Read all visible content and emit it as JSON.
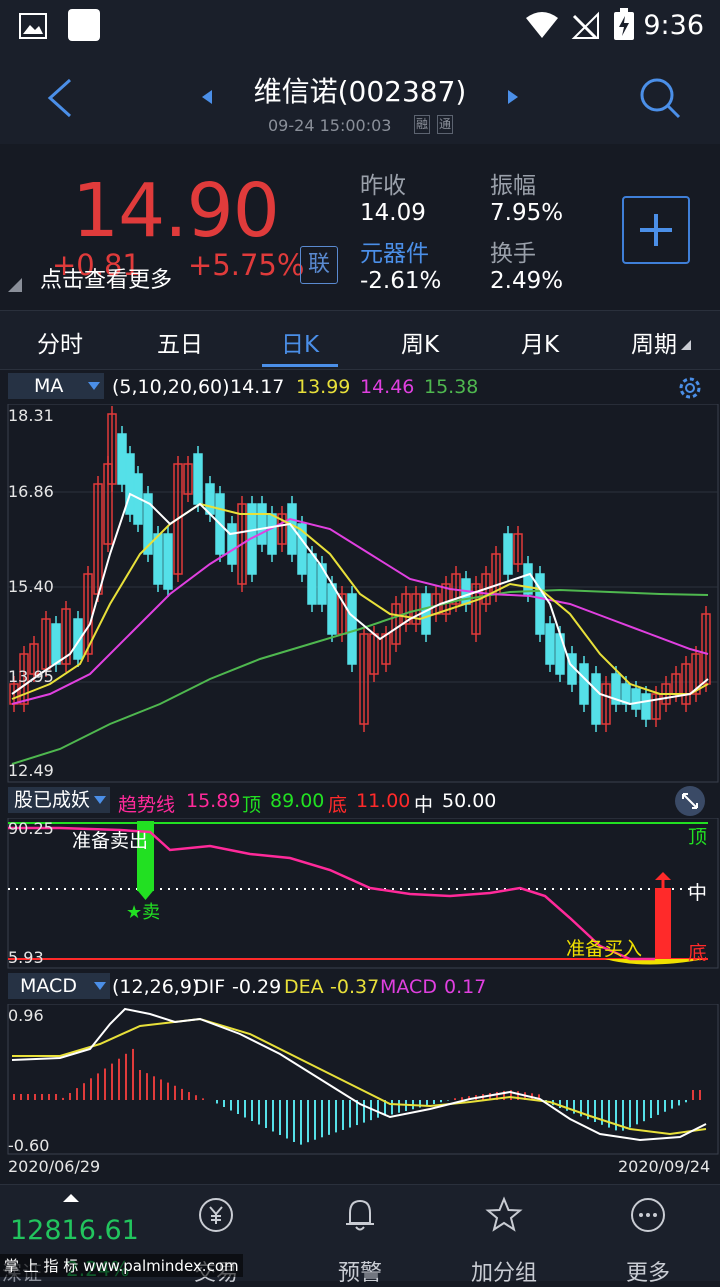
{
  "status_bar": {
    "time": "9:36"
  },
  "header": {
    "title": "维信诺(002387)",
    "timestamp": "09-24 15:00:03",
    "tags": [
      "融",
      "通"
    ]
  },
  "quote": {
    "price": "14.90",
    "change": "+0.81",
    "change_pct": "+5.75%",
    "tip": "点击查看更多",
    "link_label": "联",
    "prev_close_label": "昨收",
    "prev_close": "14.09",
    "amplitude_label": "振幅",
    "amplitude": "7.95%",
    "sector_label": "元器件",
    "sector_change": "-2.61%",
    "turnover_label": "换手",
    "turnover": "2.49%"
  },
  "tabs": [
    "分时",
    "五日",
    "日K",
    "周K",
    "月K",
    "周期"
  ],
  "active_tab": "日K",
  "ma_panel": {
    "selector": "MA",
    "params": "(5,10,20,60)",
    "ma5": "14.17",
    "ma10": "13.99",
    "ma20": "14.46",
    "ma60": "15.38",
    "y_labels": [
      "18.31",
      "16.86",
      "15.40",
      "13.95",
      "12.49"
    ]
  },
  "trend_panel": {
    "selector": "股已成妖",
    "trend_label": "趋势线",
    "trend_value": "15.89",
    "top_label": "顶",
    "top_value": "89.00",
    "bottom_label": "底",
    "bottom_value": "11.00",
    "mid_label": "中",
    "mid_value": "50.00",
    "y_top": "90.25",
    "y_bottom": "5.93",
    "sell_prep": "准备卖出",
    "sell_mark": "★卖",
    "buy_prep": "准备买入",
    "right_top": "顶",
    "right_mid": "中",
    "right_bottom": "底"
  },
  "macd_panel": {
    "selector": "MACD",
    "params": "(12,26,9)",
    "dif_label": "DIF",
    "dif": "-0.29",
    "dea_label": "DEA",
    "dea": "-0.37",
    "macd_label": "MACD",
    "macd": "0.17",
    "y_top": "0.96",
    "y_bottom": "-0.60",
    "date_start": "2020/06/29",
    "date_end": "2020/09/24"
  },
  "bottom_nav": {
    "index_value": "12816.61",
    "index_name": "深证",
    "index_pct": "2.24%",
    "items": [
      "交易",
      "预警",
      "加分组",
      "更多"
    ]
  },
  "watermark": "掌 上 指 标  www.palmindex.com",
  "colors": {
    "up": "#e03b3b",
    "down": "#55e0e8",
    "accent": "#4b8fe8",
    "ma5": "#ffffff",
    "ma10": "#e8e03a",
    "ma20": "#e040e0",
    "ma60": "#4fb84f"
  }
}
